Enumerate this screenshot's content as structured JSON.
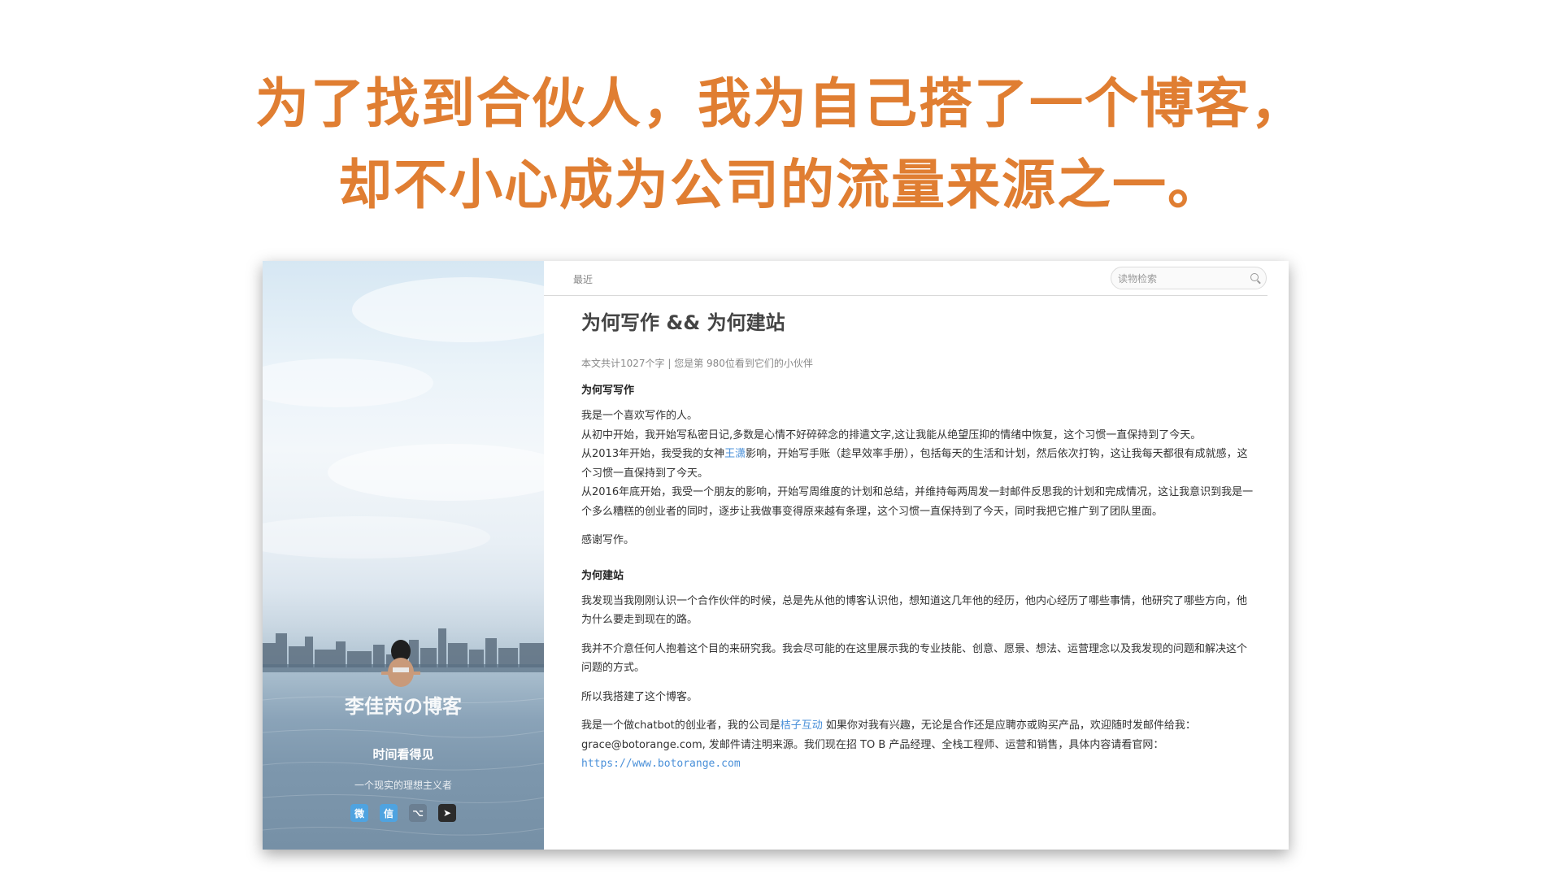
{
  "slide": {
    "headline_line1": "为了找到合伙人，我为自己搭了一个博客，",
    "headline_line2": "却不小心成为公司的流量来源之一。",
    "accent_color": "#E07E32"
  },
  "sidebar": {
    "blog_title": "李佳芮の博客",
    "subtitle": "时间看得见",
    "tagline": "一个现实的理想主义者",
    "social_icons": [
      {
        "name": "weibo-icon",
        "glyph": "微",
        "color": "#4fa3e0"
      },
      {
        "name": "wechat-icon",
        "glyph": "信",
        "color": "#4fa3e0"
      },
      {
        "name": "github-icon",
        "glyph": "⌥",
        "color": "#6b7f92"
      },
      {
        "name": "telegram-icon",
        "glyph": "➤",
        "color": "#2b2b2b"
      }
    ]
  },
  "topbar": {
    "nav_recent": "最近",
    "search_placeholder": "读物检索"
  },
  "article": {
    "title": "为何写作 && 为何建站",
    "meta": "本文共计1027个字 | 您是第 980位看到它们的小伙伴",
    "section1_heading": "为何写写作",
    "s1_p1": "我是一个喜欢写作的人。",
    "s1_p2": "从初中开始，我开始写私密日记,多数是心情不好碎碎念的排遣文字,这让我能从绝望压抑的情绪中恢复，这个习惯一直保持到了今天。",
    "s1_p3_before": "从2013年开始，我受我的女神",
    "s1_p3_link": "王潇",
    "s1_p3_after": "影响，开始写手账（趁早效率手册），包括每天的生活和计划，然后依次打钩，这让我每天都很有成就感，这个习惯一直保持到了今天。",
    "s1_p4": "从2016年底开始，我受一个朋友的影响，开始写周维度的计划和总结，并维持每两周发一封邮件反思我的计划和完成情况，这让我意识到我是一个多么糟糕的创业者的同时，逐步让我做事变得原来越有条理，这个习惯一直保持到了今天，同时我把它推广到了团队里面。",
    "s1_p5": "感谢写作。",
    "section2_heading": "为何建站",
    "s2_p1": "我发现当我刚刚认识一个合作伙伴的时候，总是先从他的博客认识他，想知道这几年他的经历，他内心经历了哪些事情，他研究了哪些方向，他为什么要走到现在的路。",
    "s2_p2": "我并不介意任何人抱着这个目的来研究我。我会尽可能的在这里展示我的专业技能、创意、愿景、想法、运营理念以及我发现的问题和解决这个问题的方式。",
    "s2_p3": "所以我搭建了这个博客。",
    "s2_p4_before": "我是一个做chatbot的创业者，我的公司是",
    "s2_p4_link": "桔子互动",
    "s2_p4_after": " 如果你对我有兴趣，无论是合作还是应聘亦或购买产品，欢迎随时发邮件给我：grace@botorange.com, 发邮件请注明来源。我们现在招 TO B 产品经理、全栈工程师、运营和销售，具体内容请看官网：",
    "s2_p4_url": "https://www.botorange.com"
  }
}
